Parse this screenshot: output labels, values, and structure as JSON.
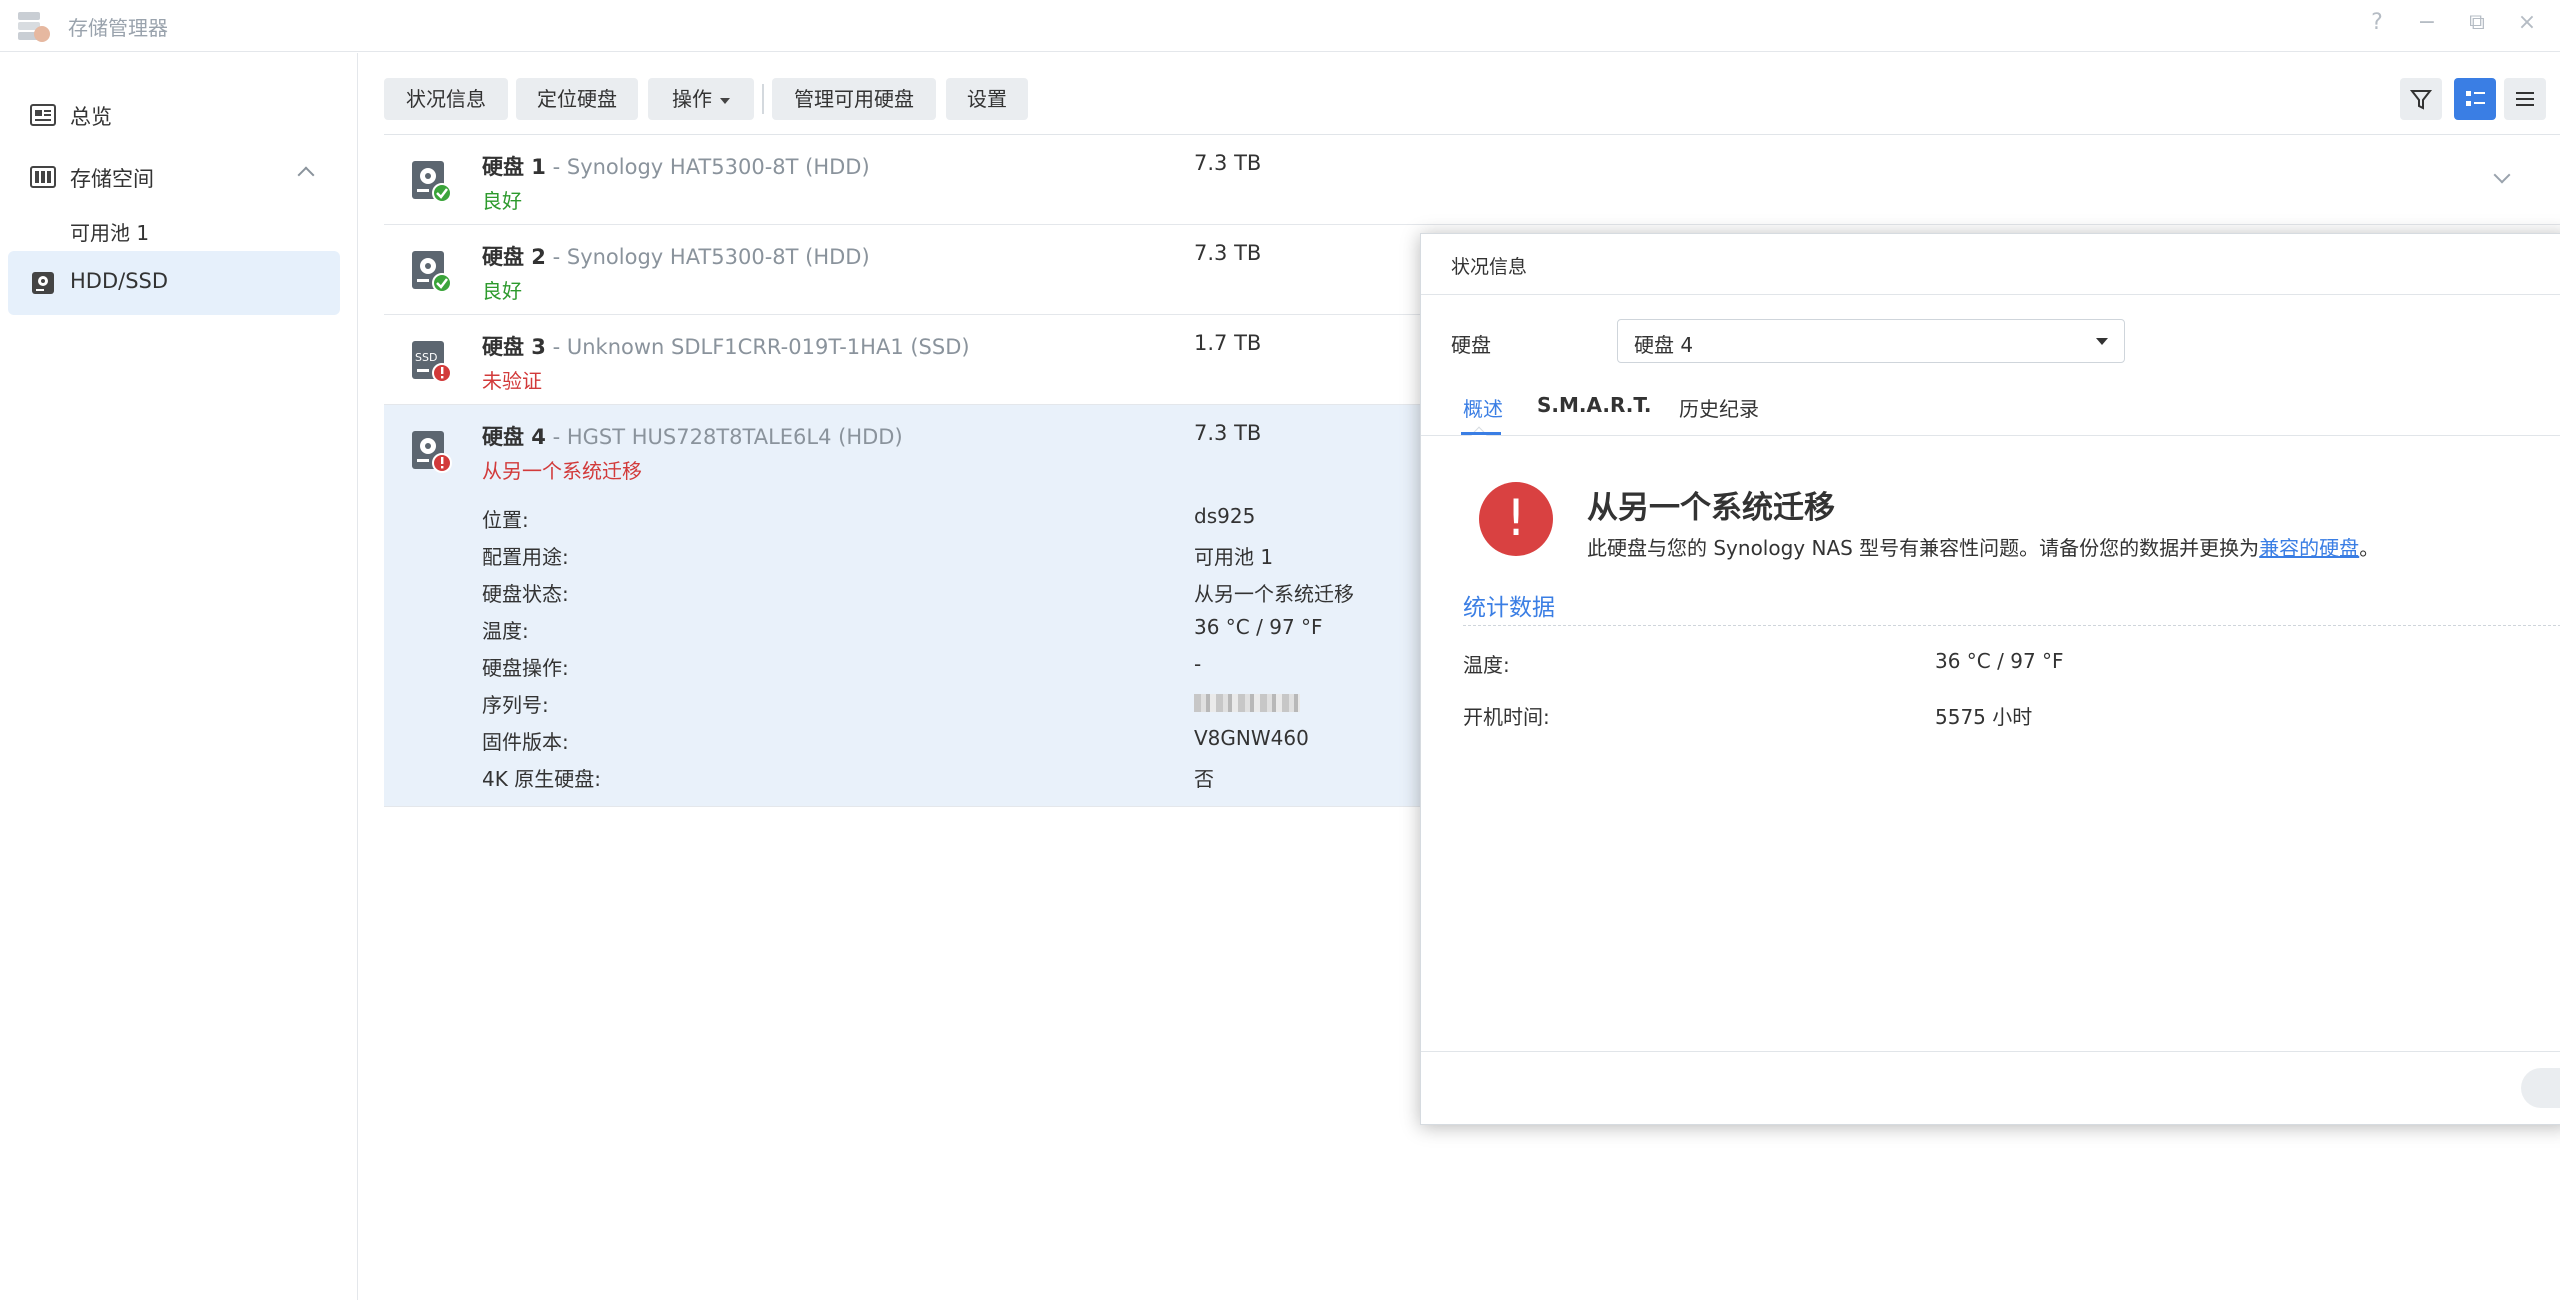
{
  "window": {
    "title": "存储管理器",
    "controls": {
      "help": "?",
      "minimize": "−",
      "restore": "⧉",
      "close": "×"
    }
  },
  "sidebar": {
    "items": [
      {
        "label": "总览",
        "icon": "overview-icon"
      },
      {
        "label": "存储空间",
        "icon": "storage-icon"
      },
      {
        "label": "可用池 1"
      },
      {
        "label": "HDD/SSD",
        "icon": "hdd-icon",
        "active": true
      }
    ]
  },
  "toolbar": {
    "status_info": "状况信息",
    "locate_disk": "定位硬盘",
    "actions": "操作",
    "manage_available": "管理可用硬盘",
    "settings": "设置"
  },
  "disks": [
    {
      "name": "硬盘 1",
      "model": " - Synology HAT5300-8T (HDD)",
      "status": "良好",
      "status_type": "ok",
      "size": "7.3 TB",
      "type": "HDD"
    },
    {
      "name": "硬盘 2",
      "model": " - Synology HAT5300-8T (HDD)",
      "status": "良好",
      "status_type": "ok",
      "size": "7.3 TB",
      "type": "HDD"
    },
    {
      "name": "硬盘 3",
      "model": " - Unknown SDLF1CRR-019T-1HA1 (SSD)",
      "status": "未验证",
      "status_type": "bad",
      "size": "1.7 TB",
      "type": "SSD"
    },
    {
      "name": "硬盘 4",
      "model": " - HGST HUS728T8TALE6L4 (HDD)",
      "status": "从另一个系统迁移",
      "status_type": "bad",
      "size": "7.3 TB",
      "type": "HDD"
    }
  ],
  "disk4_details": [
    {
      "label": "位置:",
      "value": "ds925"
    },
    {
      "label": "配置用途:",
      "value": "可用池 1"
    },
    {
      "label": "硬盘状态:",
      "value": "从另一个系统迁移"
    },
    {
      "label": "温度:",
      "value": "36 °C / 97 °F"
    },
    {
      "label": "硬盘操作:",
      "value": "-"
    },
    {
      "label": "序列号:",
      "value": ""
    },
    {
      "label": "固件版本:",
      "value": "V8GNW460"
    },
    {
      "label": "4K 原生硬盘:",
      "value": "否"
    }
  ],
  "panel": {
    "title": "状况信息",
    "disk_label": "硬盘",
    "disk_selected": "硬盘 4",
    "tabs": [
      "概述",
      "S.M.A.R.T.",
      "历史纪录"
    ],
    "warning_icon": "!",
    "warning_title": "从另一个系统迁移",
    "warning_desc": "此硬盘与您的 Synology NAS 型号有兼容性问题。请备份您的数据并更换为",
    "warning_link": "兼容的硬盘",
    "warning_end": "。",
    "stats_title": "统计数据",
    "stats": [
      {
        "label": "温度:",
        "value": "36 °C / 97 °F"
      },
      {
        "label": "开机时间:",
        "value": "5575 小时"
      }
    ]
  },
  "colors": {
    "accent": "#3a7ee4",
    "ok": "#2d9a2d",
    "error": "#d23a3a",
    "selected_row": "#e9f1fa"
  }
}
